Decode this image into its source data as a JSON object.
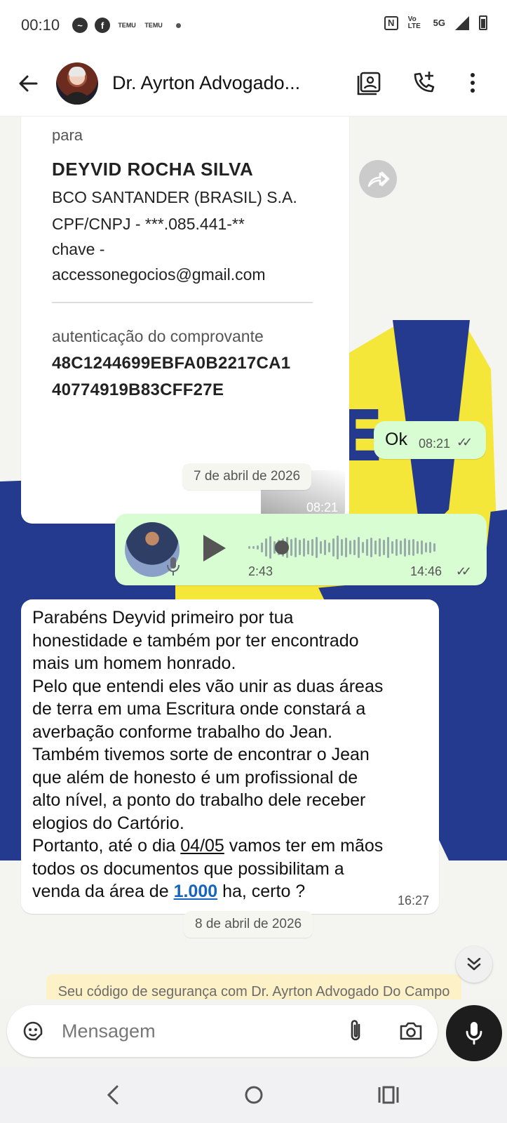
{
  "status_bar": {
    "time": "00:10",
    "left_icons": [
      "messenger-icon",
      "facebook-icon",
      "temu-icon",
      "temu-icon",
      "dot-icon"
    ],
    "temu_label": "TEMU",
    "network": "5G",
    "volte": "Vo LTE",
    "nfc": "N"
  },
  "header": {
    "contact_name": "Dr. Ayrton Advogado...",
    "icons": [
      "arrow-left-icon",
      "contact-card-icon",
      "add-call-icon",
      "more-vertical-icon"
    ]
  },
  "messages": {
    "receipt": {
      "to_label": "para",
      "recipient_name": "DEYVID ROCHA SILVA",
      "bank": "BCO SANTANDER (BRASIL) S.A.",
      "cpf": "CPF/CNPJ - ***.085.441-**",
      "key_label": "chave -",
      "key_value": "accessonegocios@gmail.com",
      "auth_label": "autenticação do comprovante",
      "auth_line1": "48C1244699EBFA0B2217CA1",
      "auth_line2": "40774919B83CFF27E",
      "time": "08:21"
    },
    "ok": {
      "text": "Ok",
      "time": "08:21",
      "ticks": "✓✓"
    },
    "date_1": "7 de abril de 2026",
    "audio": {
      "duration": "2:43",
      "time": "14:46",
      "ticks": "✓✓"
    },
    "text": {
      "lines": [
        "Parabéns Deyvid primeiro por tua",
        "honestidade e também por ter encontrado",
        "mais um homem honrado.",
        "Pelo que entendi eles vão unir as duas áreas",
        "de terra em uma Escritura onde constará a",
        "averbação conforme trabalho do Jean.",
        "Também tivemos sorte de encontrar o Jean",
        "que além de honesto é um profissional de",
        "alto nível, a ponto do trabalho dele receber",
        "elogios do Cartório."
      ],
      "line11_pre": "Portanto, até o dia ",
      "line11_date": "04/05",
      "line11_post": " vamos ter em mãos",
      "line12": "todos os documentos que possibilitam a",
      "line13_pre": "venda da área de ",
      "line13_link": "1.000",
      "line13_post": " ha, certo ?",
      "time": "16:27"
    },
    "date_2": "8 de abril de 2026",
    "security_notice": "Seu código de segurança com Dr. Ayrton Advogado Do Campo Lavrinha mudou. Toque para saber mais."
  },
  "input": {
    "placeholder": "Mensagem"
  },
  "colors": {
    "outgoing_bubble": "#d9fdd3",
    "incoming_bubble": "#ffffff",
    "link": "#1565c0",
    "notice_bg": "#fdf1c8",
    "wallpaper_yellow": "#f5e63a",
    "wallpaper_blue": "#233a8e"
  }
}
